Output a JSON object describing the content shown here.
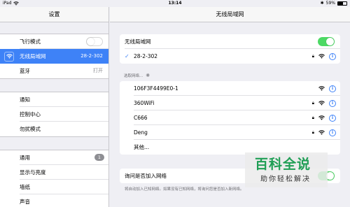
{
  "status_bar": {
    "device": "iPad",
    "time": "13:14",
    "battery": "59%",
    "battery_level": 0.59
  },
  "settings": {
    "title": "设置",
    "groups": [
      [
        {
          "label": "飞行模式",
          "icon": "airplane-icon",
          "color": "#ff9500",
          "control": "toggle-off"
        },
        {
          "label": "无线局域网",
          "icon": "wifi-icon",
          "color": "#3e82f7",
          "value": "28-2-302",
          "selected": true
        },
        {
          "label": "蓝牙",
          "icon": "bluetooth-icon",
          "color": "#007aff",
          "value": "打开"
        }
      ],
      [
        {
          "label": "通知",
          "icon": "notifications-icon",
          "color": "#8e8e93"
        },
        {
          "label": "控制中心",
          "icon": "control-center-icon",
          "color": "#8e8e93"
        },
        {
          "label": "勿扰模式",
          "icon": "moon-icon",
          "color": "#5856d6"
        }
      ],
      [
        {
          "label": "通用",
          "icon": "gear-icon",
          "color": "#8e8e93",
          "badge": "1"
        },
        {
          "label": "显示与亮度",
          "icon": "display-icon",
          "color": "#007aff"
        },
        {
          "label": "墙纸",
          "icon": "wallpaper-icon",
          "color": "#34aadc"
        },
        {
          "label": "声音",
          "icon": "sound-icon",
          "color": "#ff2d55"
        }
      ]
    ]
  },
  "wifi": {
    "title": "无线局域网",
    "toggle_label": "无线局域网",
    "toggle_on": true,
    "connected": "28-2-302",
    "choose_label": "选取网络...",
    "networks": [
      {
        "name": "106F3F4499E0-1",
        "locked": false
      },
      {
        "name": "360WiFi",
        "locked": true
      },
      {
        "name": "C666",
        "locked": true
      },
      {
        "name": "Deng",
        "locked": true
      },
      {
        "name": "其他...",
        "other": true
      }
    ],
    "ask_label": "询问是否加入网络",
    "ask_note": "将自动加入已知网络。如果没有已知网络，将询问您是否加入新网络。"
  },
  "watermark": {
    "title": "百科全说",
    "subtitle": "助你轻松解决",
    "color": "#1f9e55"
  }
}
